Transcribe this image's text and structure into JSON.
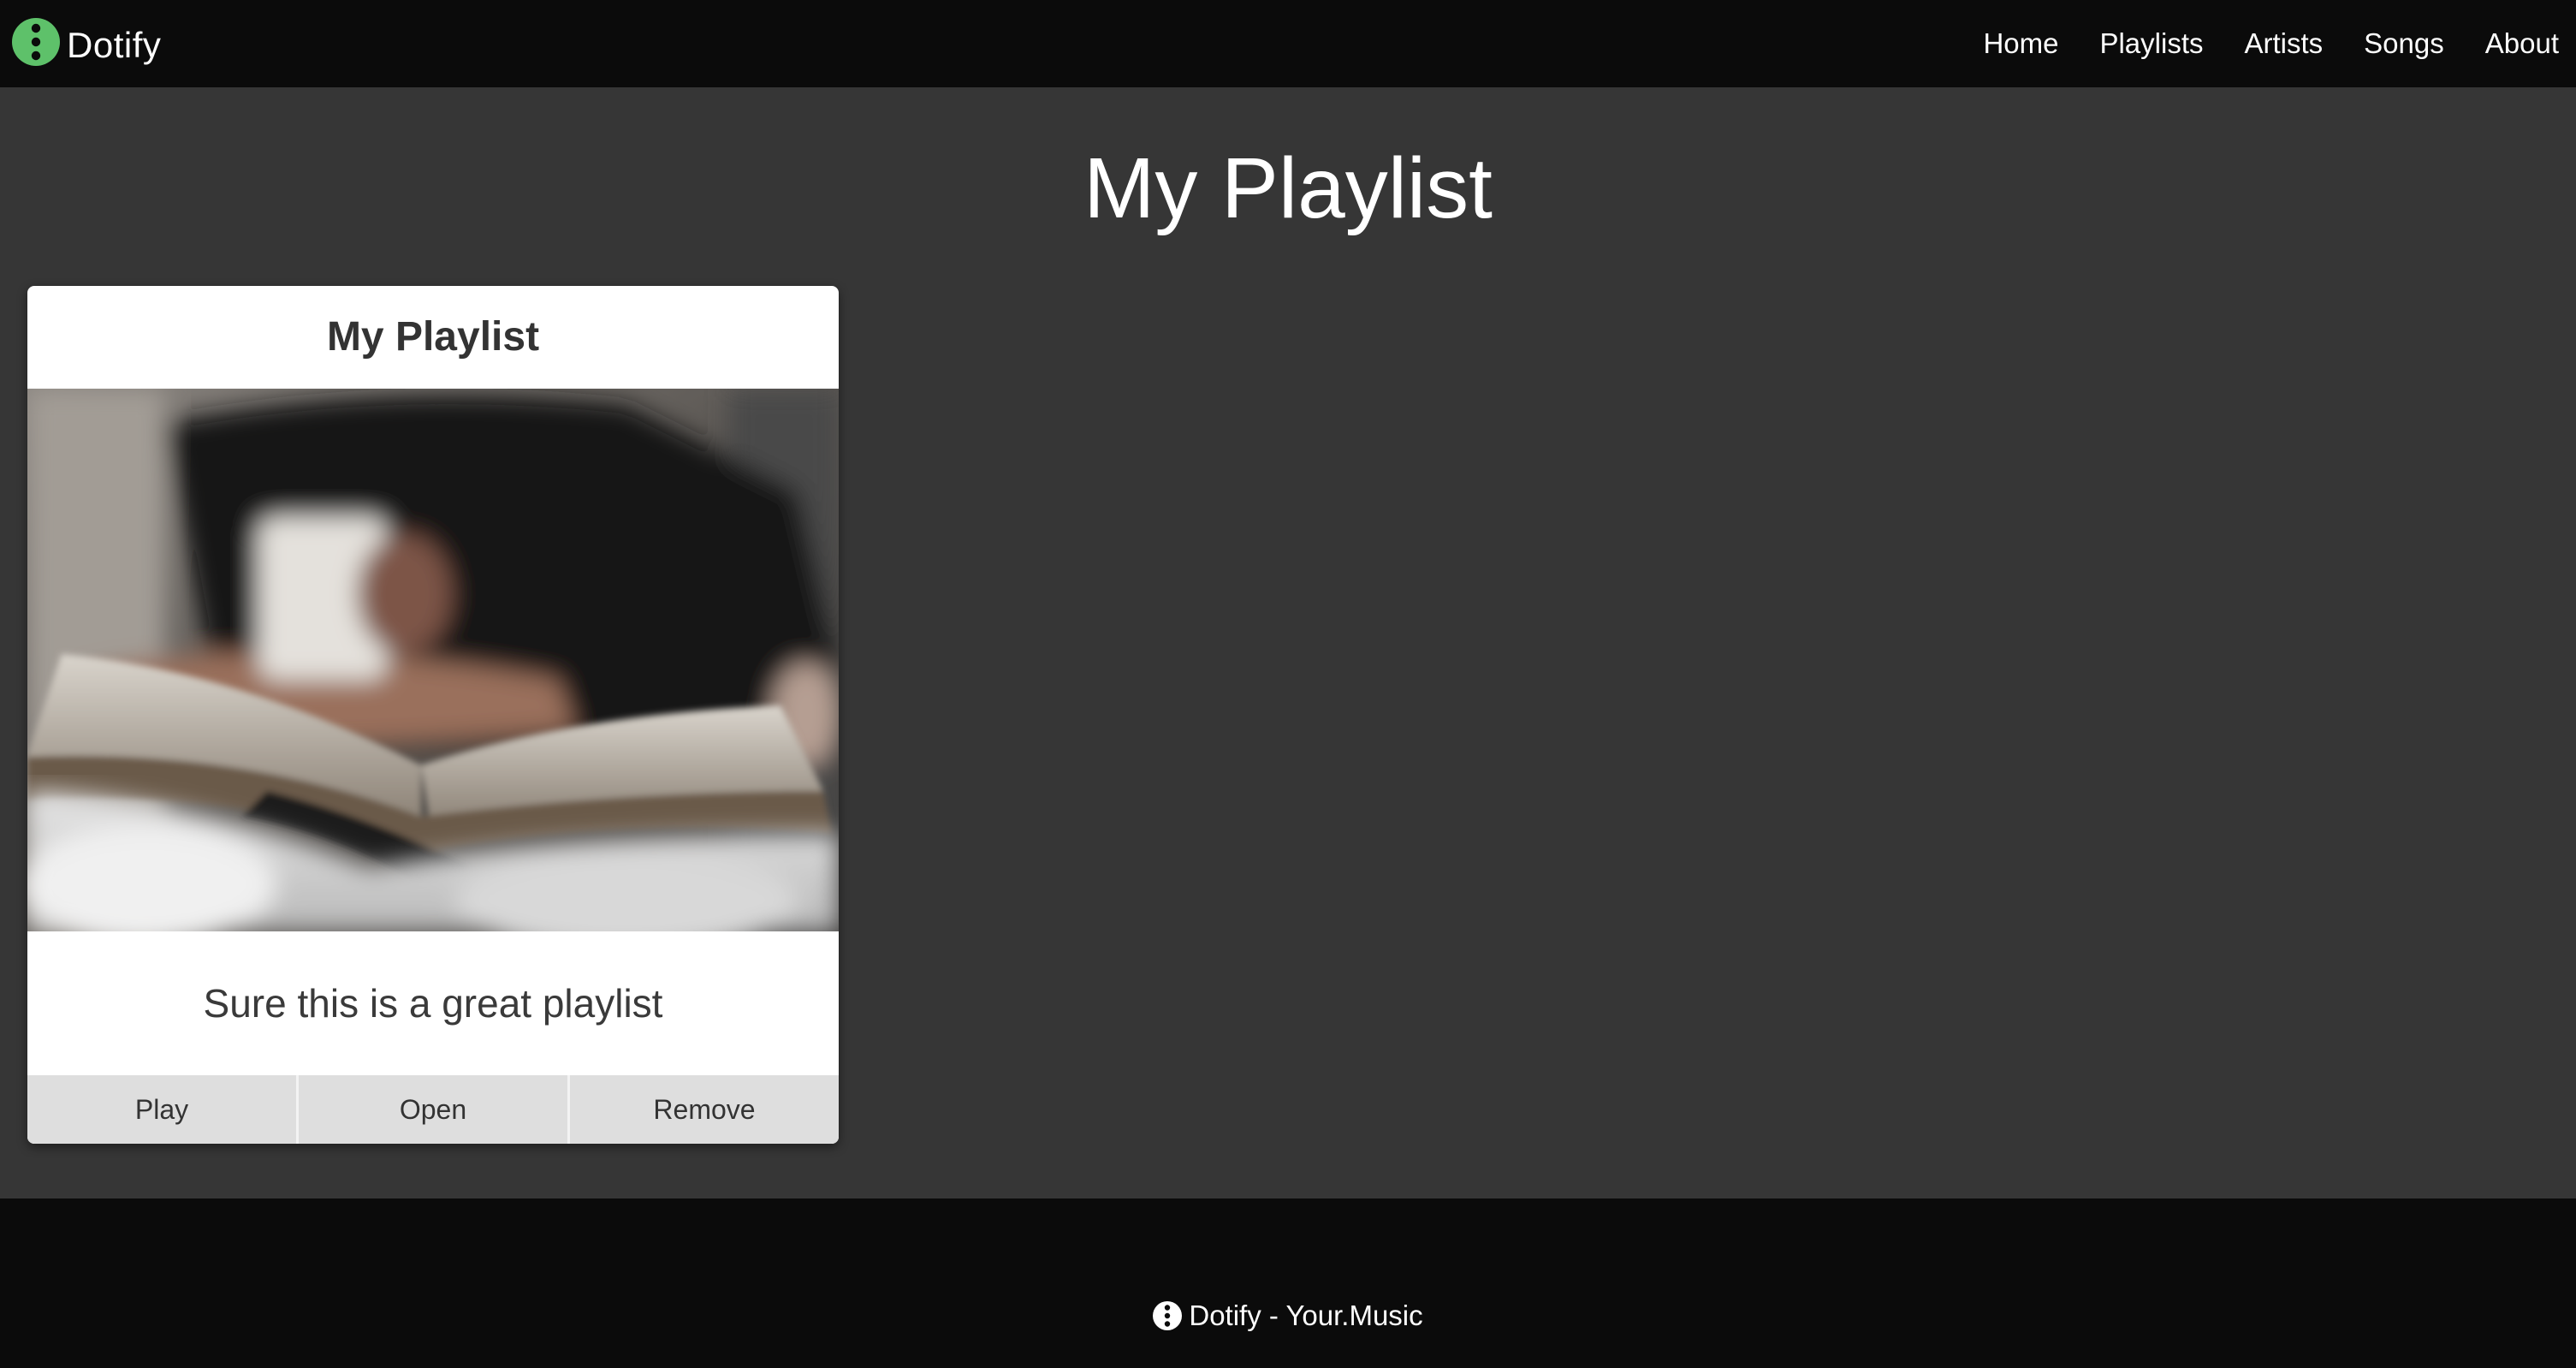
{
  "nav": {
    "brand": "Dotify",
    "links": [
      "Home",
      "Playlists",
      "Artists",
      "Songs",
      "About"
    ]
  },
  "main": {
    "title": "My Playlist"
  },
  "card": {
    "title": "My Playlist",
    "image_alt": "Person reading a book in bed holding a mug",
    "description": "Sure this is a great playlist",
    "actions": [
      "Play",
      "Open",
      "Remove"
    ]
  },
  "footer": {
    "text": "Dotify - Your.Music"
  },
  "colors": {
    "brand_green": "#5ec16a",
    "nav_background": "#0b0b0b",
    "main_background": "#363636",
    "card_background": "#ffffff",
    "button_background": "#dedede"
  },
  "icons": {
    "brand": "three-dot-logo-icon",
    "footer": "three-dot-logo-icon"
  }
}
